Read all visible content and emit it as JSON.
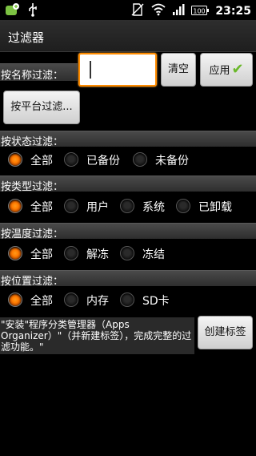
{
  "status_bar": {
    "time": "23:25",
    "left_icons": [
      "app-notification-icon",
      "usb-icon"
    ],
    "right_icons": [
      "no-sim-icon",
      "wifi-icon",
      "signal-icon",
      "battery-icon"
    ],
    "battery_label": "100"
  },
  "title": "过滤器",
  "name_filter": {
    "label": "按名称过滤：",
    "input_value": "",
    "clear_label": "清空",
    "apply_label": "应用"
  },
  "platform_button_label": "按平台过滤...",
  "status_filter": {
    "label": "按状态过滤：",
    "options": [
      "全部",
      "已备份",
      "未备份"
    ],
    "selected": "全部"
  },
  "type_filter": {
    "label": "按类型过滤：",
    "options": [
      "全部",
      "用户",
      "系统",
      "已卸载"
    ],
    "selected": "全部"
  },
  "temp_filter": {
    "label": "按温度过滤：",
    "options": [
      "全部",
      "解冻",
      "冻结"
    ],
    "selected": "全部"
  },
  "location_filter": {
    "label": "按位置过滤：",
    "options": [
      "全部",
      "内存",
      "SD卡"
    ],
    "selected": "全部"
  },
  "info_text": "\"安装\"程序分类管理器（Apps Organizer）\"（并新建标签），完成完整的过滤功能。\"",
  "create_tag_label": "创建标签",
  "colors": {
    "accent": "#ff8c00",
    "check": "#6ab82a",
    "background": "#000000"
  }
}
